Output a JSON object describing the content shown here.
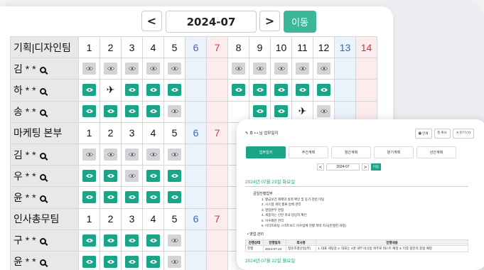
{
  "nav": {
    "prev": "<",
    "next": ">",
    "month": "2024-07",
    "go": "이동"
  },
  "days": [
    {
      "d": "1",
      "k": "n"
    },
    {
      "d": "2",
      "k": "n"
    },
    {
      "d": "3",
      "k": "n"
    },
    {
      "d": "4",
      "k": "n"
    },
    {
      "d": "5",
      "k": "n"
    },
    {
      "d": "6",
      "k": "s"
    },
    {
      "d": "7",
      "k": "u"
    },
    {
      "d": "8",
      "k": "n"
    },
    {
      "d": "9",
      "k": "n"
    },
    {
      "d": "10",
      "k": "n"
    },
    {
      "d": "11",
      "k": "n"
    },
    {
      "d": "12",
      "k": "n"
    },
    {
      "d": "13",
      "k": "s"
    },
    {
      "d": "14",
      "k": "u"
    }
  ],
  "groups": [
    {
      "name": "기획|디자인팀",
      "days_shown": 14,
      "rows": [
        {
          "name": "김 * *",
          "cells": [
            "g",
            "g",
            "g",
            "g",
            "g",
            "",
            "",
            "g",
            "g",
            "g",
            "g",
            "g",
            "",
            ""
          ]
        },
        {
          "name": "하 * *",
          "cells": [
            "t",
            "p",
            "t",
            "t",
            "t",
            "",
            "",
            "t",
            "t",
            "t",
            "t",
            "t",
            "",
            ""
          ]
        },
        {
          "name": "송 * *",
          "cells": [
            "t",
            "t",
            "t",
            "t",
            "g",
            "",
            "",
            "",
            "t",
            "t",
            "p",
            "g",
            "",
            ""
          ]
        }
      ]
    },
    {
      "name": "마케팅 본부",
      "days_shown": 7,
      "rows": [
        {
          "name": "김 * *",
          "cells": [
            "g",
            "g",
            "g",
            "g",
            "g",
            "",
            "",
            "",
            ""
          ]
        },
        {
          "name": "우 * *",
          "cells": [
            "t",
            "t",
            "g",
            "t",
            "t",
            "",
            "",
            "",
            ""
          ]
        },
        {
          "name": "윤 * *",
          "cells": [
            "t",
            "t",
            "t",
            "t",
            "t",
            "",
            "",
            "",
            ""
          ]
        }
      ]
    },
    {
      "name": "인사총무팀",
      "days_shown": 7,
      "rows": [
        {
          "name": "구 * *",
          "cells": [
            "t",
            "t",
            "t",
            "t",
            "g",
            "",
            "",
            "",
            ""
          ]
        },
        {
          "name": "윤 * *",
          "cells": [
            "t",
            "t",
            "t",
            "t",
            "g",
            "",
            "",
            "",
            ""
          ]
        }
      ]
    }
  ],
  "overlay": {
    "title": "✎ 호 • • 님 업무일지",
    "buttons": [
      "🖶 인쇄",
      "⎘ 복사",
      "✕ 닫기 (T)"
    ],
    "tabs": [
      "업무일지",
      "주간계획",
      "월간계획",
      "분기계획",
      "년간계획"
    ],
    "month": "2024-07",
    "go": "이동",
    "date1": "2024년 07월 23일 화요일",
    "heading": "금일진행업무",
    "items": [
      "1. 황금보건 제제약 실적 확인 및 동기 관련 미팅",
      "2. 시스템 개약 품류 업체 관리",
      "3. 영업본부 면접",
      "4. 세종하는 신한 귀국 담당자 확인",
      "5. 이수재관 관리",
      "6. 이미프로팅 스마트보드 이수업체 현황 파악 지시(진행진 과정)"
    ],
    "section": "• 영업 관리",
    "table_headers": [
      "진행상태",
      "진행일자",
      "회사명",
      "진행내용"
    ],
    "table_row": [
      "진행",
      "2024-07-23",
      "청운조명산업(주)",
      "1. 대표 세팅중 2. 대표는 4명 내부 비식등 위주로 테스트 예정 3. 이후 합진적 종합 예정"
    ],
    "date2": "2024년 07월 22일 월요일"
  },
  "colors": {
    "teal": "#1aa588",
    "gray": "#d2d4d7",
    "sat_bg": "#eaf2fc",
    "sun_bg": "#fdecee",
    "sat_text": "#3c66a8",
    "sun_text": "#c43a3a"
  }
}
